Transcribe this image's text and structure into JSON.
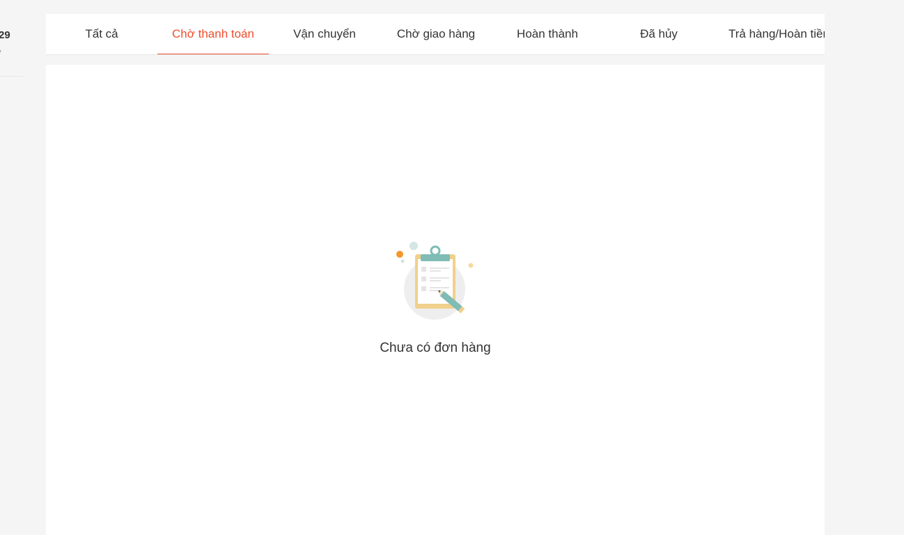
{
  "sidebar": {
    "user_name": "29",
    "user_sub": "y"
  },
  "tabs": [
    {
      "label": "Tất cả",
      "active": false
    },
    {
      "label": "Chờ thanh toán",
      "active": true
    },
    {
      "label": "Vận chuyển",
      "active": false
    },
    {
      "label": "Chờ giao hàng",
      "active": false
    },
    {
      "label": "Hoàn thành",
      "active": false
    },
    {
      "label": "Đã hủy",
      "active": false
    },
    {
      "label": "Trả hàng/Hoàn tiền",
      "active": false
    }
  ],
  "empty_state": {
    "icon": "clipboard-pencil-icon",
    "message": "Chưa có đơn hàng"
  },
  "colors": {
    "accent": "#ee4d2d",
    "background": "#f5f5f5",
    "panel": "#ffffff",
    "clipboard": "#f0d08c",
    "clip_teal": "#7fbcb5",
    "dot_orange": "#f5962a"
  }
}
